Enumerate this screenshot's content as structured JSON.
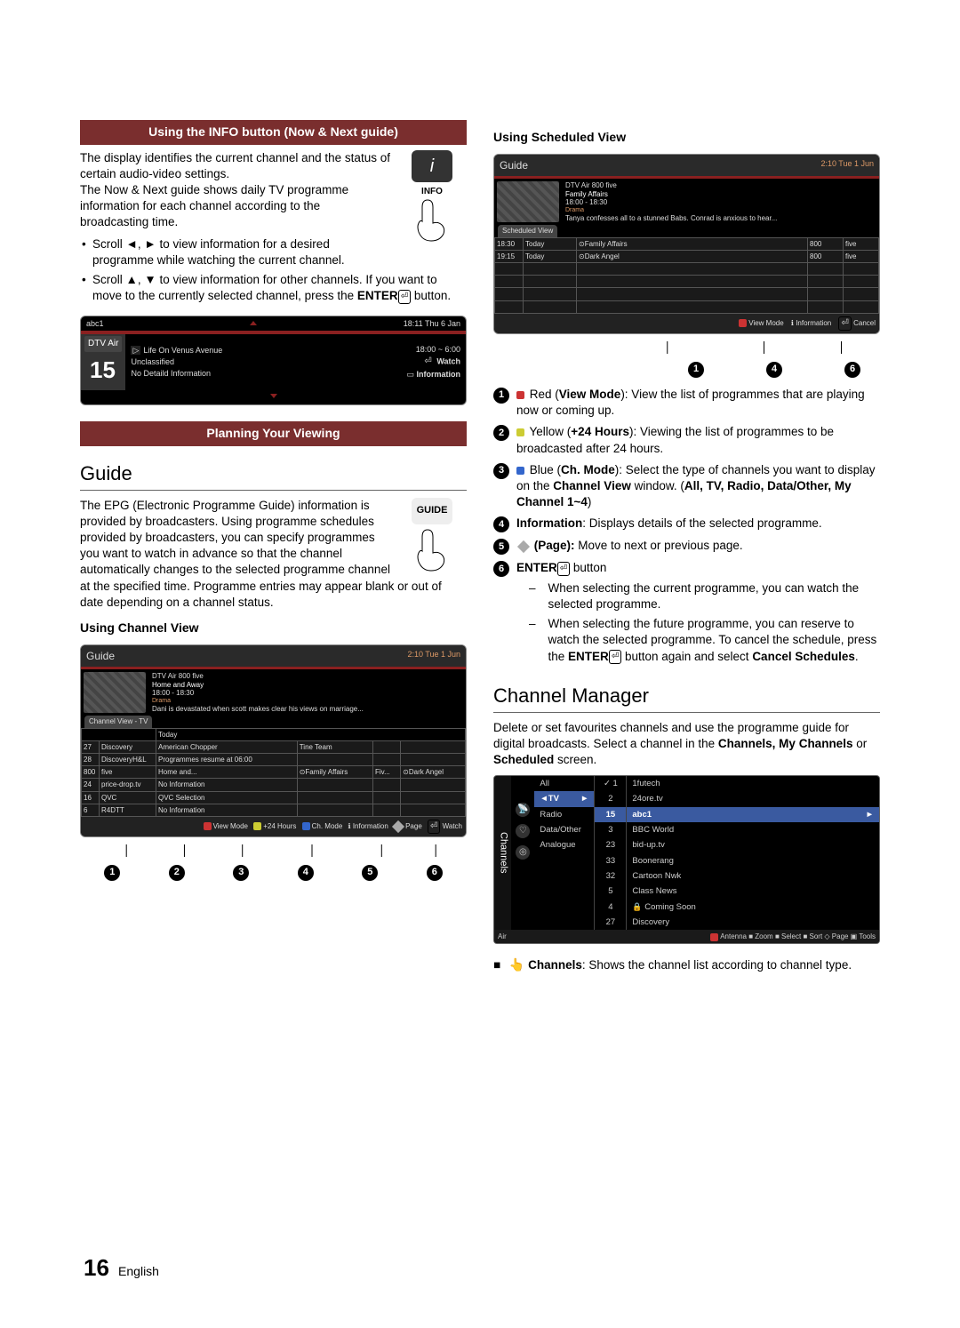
{
  "header1": "Using the INFO button (Now & Next guide)",
  "info_btn_label": "INFO",
  "p_info1": "The display identifies the current channel and the status of certain audio-video settings.",
  "p_info2": "The Now & Next guide shows daily TV programme information for each channel according to the broadcasting time.",
  "li_info1a": "Scroll ◄, ► to view information for a desired programme while watching the current channel.",
  "li_info2a": "Scroll ▲, ▼ to view information for other channels. If you want to move to the currently selected channel, press the ",
  "li_info2b": "ENTER",
  "li_info2c": " button.",
  "osd_info": {
    "abc": "abc1",
    "time": "18:11 Thu 6 Jan",
    "src": "DTV Air",
    "num": "15",
    "prog": "Life On Venus Avenue",
    "slot": "18:00 ~ 6:00",
    "class": "Unclassified",
    "nodet": "No Detaild Information",
    "watch": "Watch",
    "information": "Information"
  },
  "header2": "Planning Your Viewing",
  "h_guide": "Guide",
  "guide_btn_label": "GUIDE",
  "p_guide": "The EPG (Electronic Programme Guide) information is provided by broadcasters. Using programme schedules provided by broadcasters, you can specify programmes you want to watch in advance so that the channel automatically changes to the selected programme channel at the specified time. Programme entries may appear blank or out of date depending on a channel status.",
  "h_ucv": "Using Channel View",
  "osd_cv": {
    "title": "Guide",
    "time": "2:10 Tue 1 Jun",
    "meta_ch": "DTV Air 800 five",
    "meta_prog": "Home and Away",
    "meta_slot": "18:00 - 18:30",
    "meta_genre": "Drama",
    "meta_desc": "Dani is devastated when scott makes clear his views on marriage...",
    "tab": "Channel View - TV",
    "today": "Today",
    "rows": [
      [
        "27",
        "Discovery",
        "American Chopper",
        "Tine Team"
      ],
      [
        "28",
        "DiscoveryH&L",
        "Programmes resume at 06:00",
        "",
        "",
        ""
      ],
      [
        "800",
        "five",
        "Home and...",
        "⊙Family Affairs",
        "Fiv...",
        "⊙Dark Angel"
      ],
      [
        "24",
        "price-drop.tv",
        "No Information",
        "",
        "",
        ""
      ],
      [
        "16",
        "QVC",
        "QVC Selection",
        "",
        "",
        ""
      ],
      [
        "6",
        "R4DTT",
        "No Information",
        "",
        "",
        ""
      ]
    ],
    "foot_a": "View Mode",
    "foot_b": "+24 Hours",
    "foot_c": "Ch. Mode",
    "foot_i": "Information",
    "foot_p": "Page",
    "foot_w": "Watch"
  },
  "callouts_cv": [
    "1",
    "2",
    "3",
    "4",
    "5",
    "6"
  ],
  "h_usv": "Using Scheduled View",
  "osd_sv": {
    "title": "Guide",
    "time": "2:10 Tue 1 Jun",
    "meta_ch": "DTV Air 800 five",
    "meta_prog": "Family Affairs",
    "meta_slot": "18:00 - 18:30",
    "meta_genre": "Drama",
    "meta_desc": "Tanya confesses all to a stunned Babs. Conrad is anxious to hear...",
    "tab": "Scheduled View",
    "rows": [
      [
        "18:30",
        "Today",
        "⊙Family Affairs",
        "800",
        "five"
      ],
      [
        "19:15",
        "Today",
        "⊙Dark Angel",
        "800",
        "five"
      ]
    ],
    "foot_a": "View Mode",
    "foot_i": "Information",
    "foot_c": "Cancel"
  },
  "callouts_sv": [
    "1",
    "4",
    "6"
  ],
  "numlist": {
    "i1a": "Red (",
    "i1b": "View Mode",
    "i1c": "): View the list of programmes that are playing now or coming up.",
    "i2a": "Yellow (",
    "i2b": "+24 Hours",
    "i2c": "): Viewing the list of programmes to be broadcasted after 24 hours.",
    "i3a": "Blue (",
    "i3b": "Ch. Mode",
    "i3c": "): Select the type of channels you want to display on the ",
    "i3d": "Channel View",
    "i3e": " window. (",
    "i3f": "All, TV, Radio, Data/Other, My Channel 1~4",
    "i3g": ")",
    "i4a": "Information",
    "i4b": ": Displays details of the selected programme.",
    "i5a": "(Page):",
    "i5b": " Move to next or previous page.",
    "i6a": "ENTER",
    "i6b": " button",
    "i6s1": "When selecting the current programme, you can watch the selected programme.",
    "i6s2a": "When selecting the future programme, you can reserve to watch the selected programme. To cancel the schedule, press the ",
    "i6s2b": "ENTER",
    "i6s2c": " button again and select ",
    "i6s2d": "Cancel Schedules",
    "i6s2e": "."
  },
  "h_cm": "Channel Manager",
  "p_cm_a": "Delete or set favourites channels and use the programme guide for digital broadcasts. Select a channel in the ",
  "p_cm_b": "Channels, My Channels",
  "p_cm_c": " or ",
  "p_cm_d": "Scheduled",
  "p_cm_e": " screen.",
  "cm": {
    "side": "Channels",
    "cats": [
      "All",
      "TV",
      "Radio",
      "Data/Other",
      "Analogue"
    ],
    "nums": [
      "1",
      "2",
      "15",
      "3",
      "23",
      "33",
      "32",
      "5",
      "4",
      "27"
    ],
    "names": [
      "1futech",
      "24ore.tv",
      "abc1",
      "BBC World",
      "bid-up.tv",
      "Boonerang",
      "Cartoon Nwk",
      "Class News",
      "Coming Soon",
      "Discovery"
    ],
    "check": "✓",
    "lock": "🔒",
    "foot_l": "Air",
    "foot_r": "Antenna ■ Zoom ■ Select ■ Sort ◇ Page ▣ Tools"
  },
  "p_ch_note_a": "Channels",
  "p_ch_note_b": ": Shows the channel list according to channel type.",
  "page_num": "16",
  "page_lang": "English"
}
